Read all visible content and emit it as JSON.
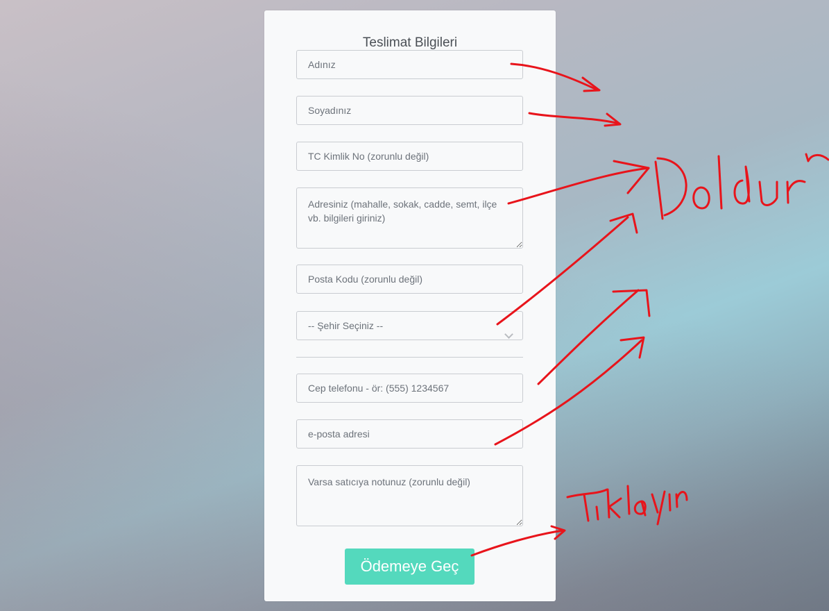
{
  "form": {
    "title": "Teslimat Bilgileri",
    "first_name_placeholder": "Adınız",
    "last_name_placeholder": "Soyadınız",
    "tc_placeholder": "TC Kimlik No (zorunlu değil)",
    "address_placeholder": "Adresiniz (mahalle, sokak, cadde, semt, ilçe vb. bilgileri giriniz)",
    "postal_placeholder": "Posta Kodu (zorunlu değil)",
    "city_selected": "-- Şehir Seçiniz --",
    "phone_placeholder": "Cep telefonu - ör: (555) 1234567",
    "email_placeholder": "e-posta adresi",
    "note_placeholder": "Varsa satıcıya notunuz (zorunlu değil)",
    "submit_label": "Ödemeye Geç"
  },
  "annotations": {
    "fill_text": "Doldurun",
    "click_text": "Tıklayın",
    "ink_color": "#e8141b"
  },
  "colors": {
    "accent": "#54d9bd",
    "card": "#f8f9fa"
  }
}
